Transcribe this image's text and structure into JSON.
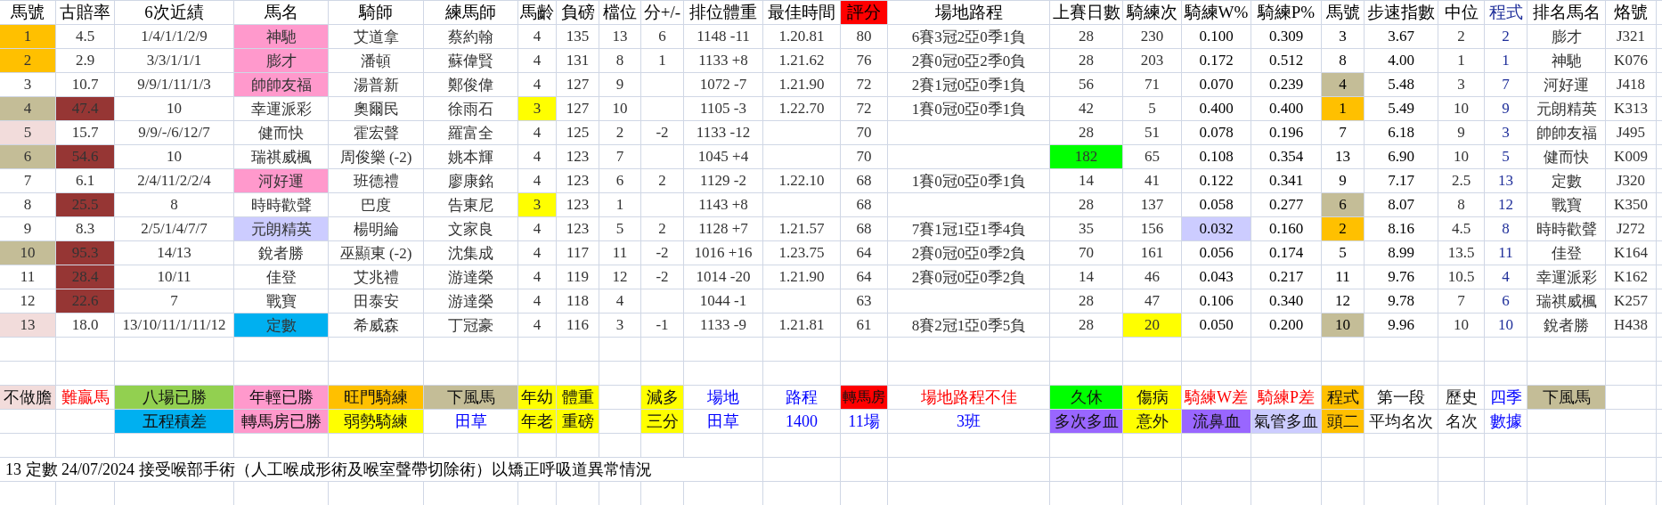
{
  "columns": [
    {
      "label": "馬號"
    },
    {
      "label": "古賠率"
    },
    {
      "label": "6次近績"
    },
    {
      "label": "馬名"
    },
    {
      "label": "騎師"
    },
    {
      "label": "練馬師"
    },
    {
      "label": "馬齡"
    },
    {
      "label": "負磅"
    },
    {
      "label": "檔位"
    },
    {
      "label": "分+/-"
    },
    {
      "label": "排位體重"
    },
    {
      "label": "最佳時間"
    },
    {
      "label": "評分",
      "color": "#ff0000"
    },
    {
      "label": "場地路程"
    },
    {
      "label": "上賽日數"
    },
    {
      "label": "騎練次"
    },
    {
      "label": "騎練W%"
    },
    {
      "label": "騎練P%"
    },
    {
      "label": "馬號"
    },
    {
      "label": "步速指數"
    },
    {
      "label": "中位"
    },
    {
      "label": "程式",
      "kind": "program"
    },
    {
      "label": "排名馬名"
    },
    {
      "label": "烙號"
    }
  ],
  "rows": [
    [
      {
        "text": "1",
        "color": "#ffc000"
      },
      "4.5",
      "1/4/1/1/2/9",
      {
        "text": "神馳",
        "color": "#ff99cc"
      },
      "艾道拿",
      "蔡約翰",
      "4",
      "135",
      "13",
      "6",
      "1148 -11",
      "1.20.81",
      "80",
      "6賽3冠2亞0季1負",
      "28",
      "230",
      "0.100",
      "0.309",
      "3",
      "3.67",
      "2",
      "2",
      "膨才",
      "J321"
    ],
    [
      {
        "text": "2",
        "color": "#ffc000"
      },
      "2.9",
      "3/3/1/1/1",
      {
        "text": "膨才",
        "color": "#ff99cc"
      },
      "潘頓",
      "蘇偉賢",
      "4",
      "131",
      "8",
      "1",
      "1133 +8",
      "1.21.62",
      "76",
      "2賽0冠0亞2季0負",
      "28",
      "203",
      "0.172",
      "0.512",
      "8",
      "4.00",
      "1",
      "1",
      "神馳",
      "K076"
    ],
    [
      "3",
      "10.7",
      "9/9/1/11/1/3",
      {
        "text": "帥帥友福",
        "color": "#ff99cc"
      },
      "湯普新",
      "鄭俊偉",
      "4",
      "127",
      "9",
      null,
      "1072 -7",
      "1.21.90",
      "72",
      "2賽1冠0亞0季1負",
      "56",
      "71",
      "0.070",
      "0.239",
      {
        "text": "4",
        "color": "#c4bd97"
      },
      "5.48",
      "3",
      "7",
      "河好運",
      "J418"
    ],
    [
      {
        "text": "4",
        "color": "#c4bd97"
      },
      {
        "text": "47.4",
        "color": "#963634"
      },
      "10",
      "幸運派彩",
      "奧爾民",
      "徐雨石",
      {
        "text": "3",
        "color": "#ffff00"
      },
      "127",
      "10",
      null,
      "1105 -3",
      "1.22.70",
      "72",
      "1賽0冠0亞0季1負",
      "42",
      "5",
      "0.400",
      "0.400",
      {
        "text": "1",
        "color": "#ffc000"
      },
      "5.49",
      "10",
      "9",
      "元朗精英",
      "K313"
    ],
    [
      {
        "text": "5",
        "color": "#f2dcdb"
      },
      "15.7",
      "9/9/-/6/12/7",
      "健而快",
      "霍宏聲",
      "羅富全",
      "4",
      "125",
      "2",
      "-2",
      "1133 -12",
      null,
      "70",
      null,
      "28",
      "51",
      "0.078",
      "0.196",
      "7",
      "6.18",
      "9",
      "3",
      "帥帥友福",
      "J495"
    ],
    [
      {
        "text": "6",
        "color": "#c4bd97"
      },
      {
        "text": "54.6",
        "color": "#963634"
      },
      "10",
      "瑞祺威楓",
      "周俊樂 (-2)",
      "姚本輝",
      "4",
      "123",
      "7",
      null,
      "1045 +4",
      null,
      "70",
      null,
      {
        "text": "182",
        "color": "#00ff00"
      },
      "65",
      "0.108",
      "0.354",
      "13",
      "6.90",
      "10",
      "5",
      "健而快",
      "K009"
    ],
    [
      "7",
      "6.1",
      "2/4/11/2/2/4",
      {
        "text": "河好運",
        "color": "#ff99cc"
      },
      "班德禮",
      "廖康銘",
      "4",
      "123",
      "6",
      "2",
      "1129 -2",
      "1.22.10",
      "68",
      "1賽0冠0亞0季1負",
      "14",
      "41",
      "0.122",
      "0.341",
      "9",
      "7.17",
      "2.5",
      "13",
      "定數",
      "J320"
    ],
    [
      "8",
      {
        "text": "25.5",
        "color": "#963634"
      },
      "8",
      "時時歡聲",
      "巴度",
      "告東尼",
      {
        "text": "3",
        "color": "#ffff00"
      },
      "123",
      "1",
      null,
      "1143 +8",
      null,
      "68",
      null,
      "28",
      "137",
      "0.058",
      "0.277",
      {
        "text": "6",
        "color": "#c4bd97"
      },
      "8.07",
      "8",
      "12",
      "戰寶",
      "K350"
    ],
    [
      "9",
      "8.3",
      "2/5/1/4/7/7",
      {
        "text": "元朗精英",
        "color": "#ccccff"
      },
      "楊明綸",
      "文家良",
      "4",
      "123",
      "5",
      "2",
      "1128 +7",
      "1.21.57",
      "68",
      "7賽1冠1亞1季4負",
      "35",
      "156",
      {
        "text": "0.032",
        "color": "#ccccff"
      },
      "0.160",
      {
        "text": "2",
        "color": "#ffc000"
      },
      "8.16",
      "4.5",
      "8",
      "時時歡聲",
      "J272"
    ],
    [
      {
        "text": "10",
        "color": "#c4bd97"
      },
      {
        "text": "95.3",
        "color": "#963634"
      },
      "14/13",
      "銳者勝",
      "巫顯東 (-2)",
      "沈集成",
      "4",
      "117",
      "11",
      "-2",
      "1016 +16",
      "1.23.75",
      "64",
      "2賽0冠0亞0季2負",
      "70",
      "161",
      "0.056",
      "0.174",
      "5",
      "8.99",
      "13.5",
      "11",
      "佳登",
      "K164"
    ],
    [
      "11",
      {
        "text": "28.4",
        "color": "#963634"
      },
      "10/11",
      "佳登",
      "艾兆禮",
      "游達榮",
      "4",
      "119",
      "12",
      "-2",
      "1014 -20",
      "1.21.90",
      "64",
      "2賽0冠0亞0季2負",
      "14",
      "46",
      "0.043",
      "0.217",
      "11",
      "9.76",
      "10.5",
      "4",
      "幸運派彩",
      "K162"
    ],
    [
      "12",
      {
        "text": "22.6",
        "color": "#963634"
      },
      "7",
      "戰寶",
      "田泰安",
      "游達榮",
      "4",
      "118",
      "4",
      null,
      "1044 -1",
      null,
      "63",
      null,
      "28",
      "47",
      "0.106",
      "0.340",
      "12",
      "9.78",
      "7",
      "6",
      "瑞祺威楓",
      "K257"
    ],
    [
      {
        "text": "13",
        "color": "#f2dcdb"
      },
      "18.0",
      "13/10/11/1/11/12",
      {
        "text": "定數",
        "color": "#00b0f0"
      },
      "希威森",
      "丁冠豪",
      "4",
      "116",
      "3",
      "-1",
      "1133 -9",
      "1.21.81",
      "61",
      "8賽2冠1亞0季5負",
      "28",
      {
        "text": "20",
        "color": "#ffff00"
      },
      "0.050",
      "0.200",
      {
        "text": "10",
        "color": "#c4bd97"
      },
      "9.96",
      "10",
      "10",
      "銳者勝",
      "H438"
    ]
  ],
  "legend_rows": [
    [
      {
        "text": "不做膽",
        "color": "#f2dcdb"
      },
      {
        "text": "難贏馬",
        "kind": "alert"
      },
      {
        "text": "八場已勝",
        "color": "#92d050"
      },
      {
        "text": "年輕已勝",
        "color": "#ff99cc"
      },
      {
        "text": "旺門騎練",
        "color": "#ffc000"
      },
      {
        "text": "下風馬",
        "color": "#c4bd97"
      },
      {
        "text": "年幼",
        "color": "#ffff00"
      },
      {
        "text": "體重",
        "color": "#ffff00"
      },
      null,
      {
        "text": "減多",
        "color": "#ffff00"
      },
      {
        "text": "場地",
        "kind": "info"
      },
      {
        "text": "路程",
        "kind": "info"
      },
      {
        "text": "轉馬房",
        "color": "#ff0000"
      },
      {
        "text": "場地路程不佳",
        "kind": "alert"
      },
      {
        "text": "久休",
        "color": "#00ff00"
      },
      {
        "text": "傷病",
        "color": "#ffff00"
      },
      {
        "text": "騎練W差",
        "kind": "alert"
      },
      {
        "text": "騎練P差",
        "kind": "alert"
      },
      {
        "text": "程式",
        "color": "#ffc000"
      },
      {
        "text": "第一段"
      },
      {
        "text": "歷史"
      },
      {
        "text": "四季",
        "kind": "info"
      },
      {
        "text": "下風馬",
        "color": "#c4bd97"
      },
      null
    ],
    [
      null,
      null,
      {
        "text": "五程積差",
        "color": "#00b0f0"
      },
      {
        "text": "轉馬房已勝",
        "color": "#ff99cc"
      },
      {
        "text": "弱勢騎練",
        "color": "#ffff00"
      },
      {
        "text": "田草",
        "kind": "info"
      },
      {
        "text": "年老",
        "color": "#ffff00"
      },
      {
        "text": "重磅",
        "color": "#ffff00"
      },
      null,
      {
        "text": "三分",
        "color": "#ffff00"
      },
      {
        "text": "田草",
        "kind": "info"
      },
      {
        "text": "1400",
        "kind": "info"
      },
      {
        "text": "11場",
        "kind": "info"
      },
      {
        "text": "3班",
        "kind": "info"
      },
      {
        "text": "多次多血",
        "color": "#9966ff"
      },
      {
        "text": "意外",
        "color": "#ffff00"
      },
      {
        "text": "流鼻血",
        "color": "#9966ff"
      },
      {
        "text": "氣管多血",
        "color": "#ccccff"
      },
      {
        "text": "頭二",
        "color": "#ffc000"
      },
      {
        "text": "平均名次"
      },
      {
        "text": "名次"
      },
      {
        "text": "數據",
        "kind": "info"
      },
      null,
      null
    ]
  ],
  "note": "13 定數  24/07/2024  接受喉部手術（人工喉成形術及喉室聲帶切除術）以矯正呼吸道異常情況"
}
